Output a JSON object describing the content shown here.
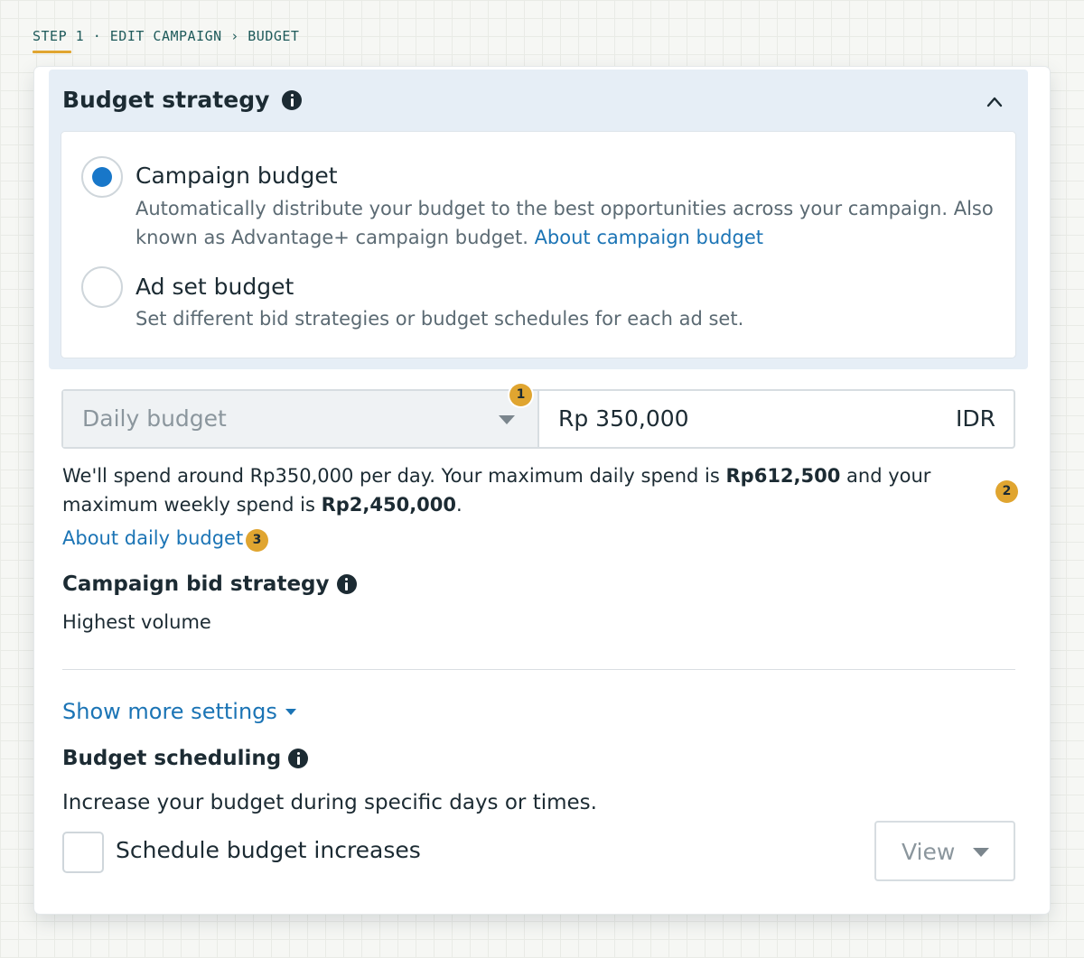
{
  "breadcrumb": {
    "text": "STEP 1 · EDIT CAMPAIGN › BUDGET"
  },
  "budget_strategy": {
    "title": "Budget strategy",
    "options": [
      {
        "title": "Campaign budget",
        "description": "Automatically distribute your budget to the best opportunities across your campaign. Also known as Advantage+ campaign budget.",
        "link": "About campaign budget",
        "selected": true
      },
      {
        "title": "Ad set budget",
        "description": "Set different bid strategies or budget schedules for each ad set.",
        "selected": false
      }
    ]
  },
  "budget": {
    "type_selected": "Daily budget",
    "amount": "Rp 350,000",
    "currency": "IDR",
    "summary_part1": "We'll spend around Rp350,000 per day. Your maximum daily spend is ",
    "max_daily": "Rp612,500",
    "summary_part2": " and your maximum weekly spend is ",
    "max_weekly": "Rp2,450,000",
    "summary_part3": ".",
    "about_link": "About daily budget"
  },
  "bid_strategy": {
    "title": "Campaign bid strategy",
    "value": "Highest volume"
  },
  "more_settings": {
    "label": "Show more settings"
  },
  "budget_scheduling": {
    "title": "Budget scheduling",
    "description": "Increase your budget during specific days or times.",
    "checkbox_label": "Schedule budget increases",
    "checked": false,
    "view_button": "View"
  },
  "badges": [
    "1",
    "2",
    "3"
  ],
  "colors": {
    "accent": "#1877c9",
    "link": "#1b74b5",
    "badge": "#e0a530",
    "section_bg": "#e6eef6"
  }
}
